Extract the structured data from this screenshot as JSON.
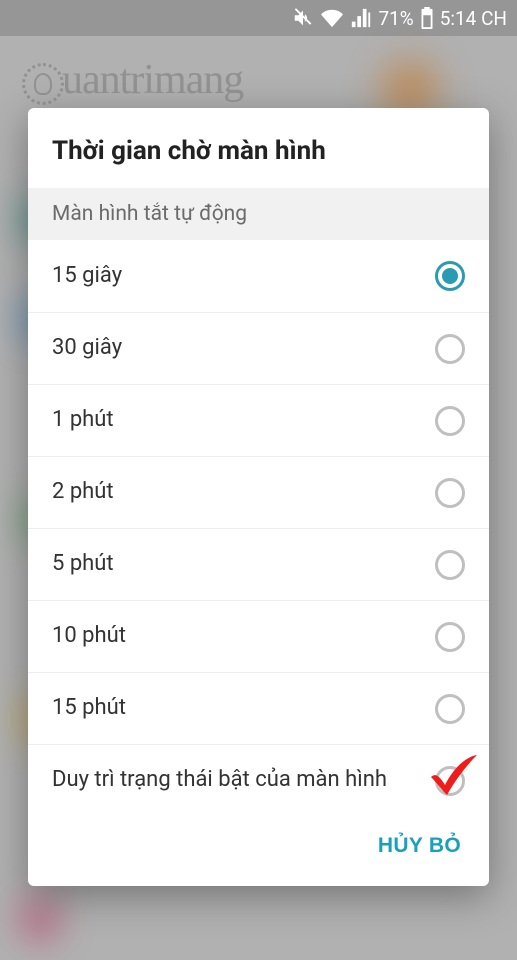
{
  "status_bar": {
    "battery_percent": "71%",
    "time": "5:14 CH"
  },
  "watermark": {
    "text": "uantrimang"
  },
  "dialog": {
    "title": "Thời gian chờ màn hình",
    "section_label": "Màn hình tắt tự động",
    "options": [
      {
        "label": "15 giây",
        "selected": true
      },
      {
        "label": "30 giây",
        "selected": false
      },
      {
        "label": "1 phút",
        "selected": false
      },
      {
        "label": "2 phút",
        "selected": false
      },
      {
        "label": "5 phút",
        "selected": false
      },
      {
        "label": "10 phút",
        "selected": false
      },
      {
        "label": "15 phút",
        "selected": false
      },
      {
        "label": "Duy trì trạng thái bật của màn hình",
        "selected": false
      }
    ],
    "cancel_label": "HỦY BỎ"
  },
  "annotation": {
    "type": "red-checkmark",
    "target_option_index": 7
  }
}
